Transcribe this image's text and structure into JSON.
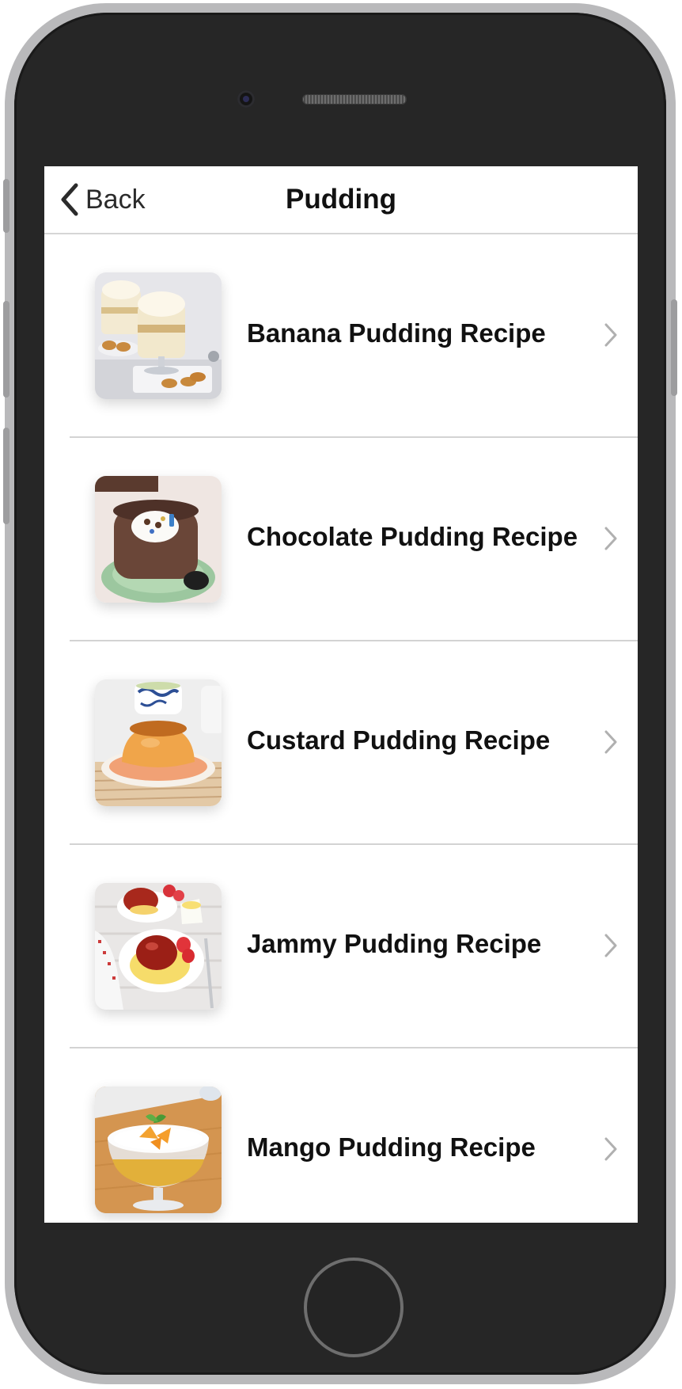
{
  "navbar": {
    "back_label": "Back",
    "title": "Pudding"
  },
  "recipes": [
    {
      "label": "Banana Pudding Recipe",
      "image": "banana-pudding-photo"
    },
    {
      "label": "Chocolate Pudding Recipe",
      "image": "chocolate-pudding-photo"
    },
    {
      "label": "Custard Pudding Recipe",
      "image": "custard-pudding-photo"
    },
    {
      "label": "Jammy Pudding Recipe",
      "image": "jammy-pudding-photo"
    },
    {
      "label": "Mango Pudding Recipe",
      "image": "mango-pudding-photo"
    }
  ],
  "icons": {
    "back": "chevron-left-icon",
    "disclosure": "chevron-right-icon"
  },
  "colors": {
    "screen_background": "#ffffff",
    "phone_body": "#262626",
    "separator": "#d3d3d3",
    "chevron": "#b0b0b0",
    "text": "#111111"
  }
}
